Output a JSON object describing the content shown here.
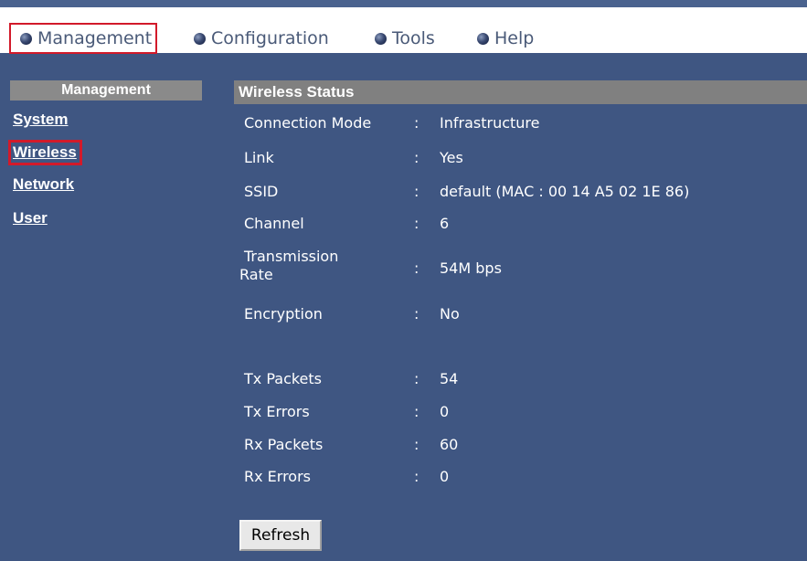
{
  "menubar": {
    "items": [
      {
        "label": "Management"
      },
      {
        "label": "Configuration"
      },
      {
        "label": "Tools"
      },
      {
        "label": "Help"
      }
    ]
  },
  "sidebar": {
    "header": "Management",
    "links": [
      {
        "label": "System"
      },
      {
        "label": "Wireless"
      },
      {
        "label": "Network"
      },
      {
        "label": "User"
      }
    ]
  },
  "status": {
    "title": "Wireless Status",
    "separator": ":",
    "rows": [
      {
        "label": "Connection Mode",
        "value": "Infrastructure"
      },
      {
        "label": "Link",
        "value": "Yes"
      },
      {
        "label": "SSID",
        "value": "default (MAC : 00 14 A5 02 1E 86)"
      },
      {
        "label": "Channel",
        "value": "6"
      },
      {
        "label_line1": "Transmission",
        "label_line2": "Rate",
        "value": "54M bps"
      },
      {
        "label": "Encryption",
        "value": "No"
      },
      {
        "label": "Tx Packets",
        "value": "54"
      },
      {
        "label": "Tx Errors",
        "value": "0"
      },
      {
        "label": "Rx Packets",
        "value": "60"
      },
      {
        "label": "Rx Errors",
        "value": "0"
      }
    ],
    "refresh_label": "Refresh"
  },
  "colors": {
    "background": "#3f5682",
    "header_bar": "#808080",
    "highlight": "#d21a2a",
    "menubar": "#ffffff"
  }
}
